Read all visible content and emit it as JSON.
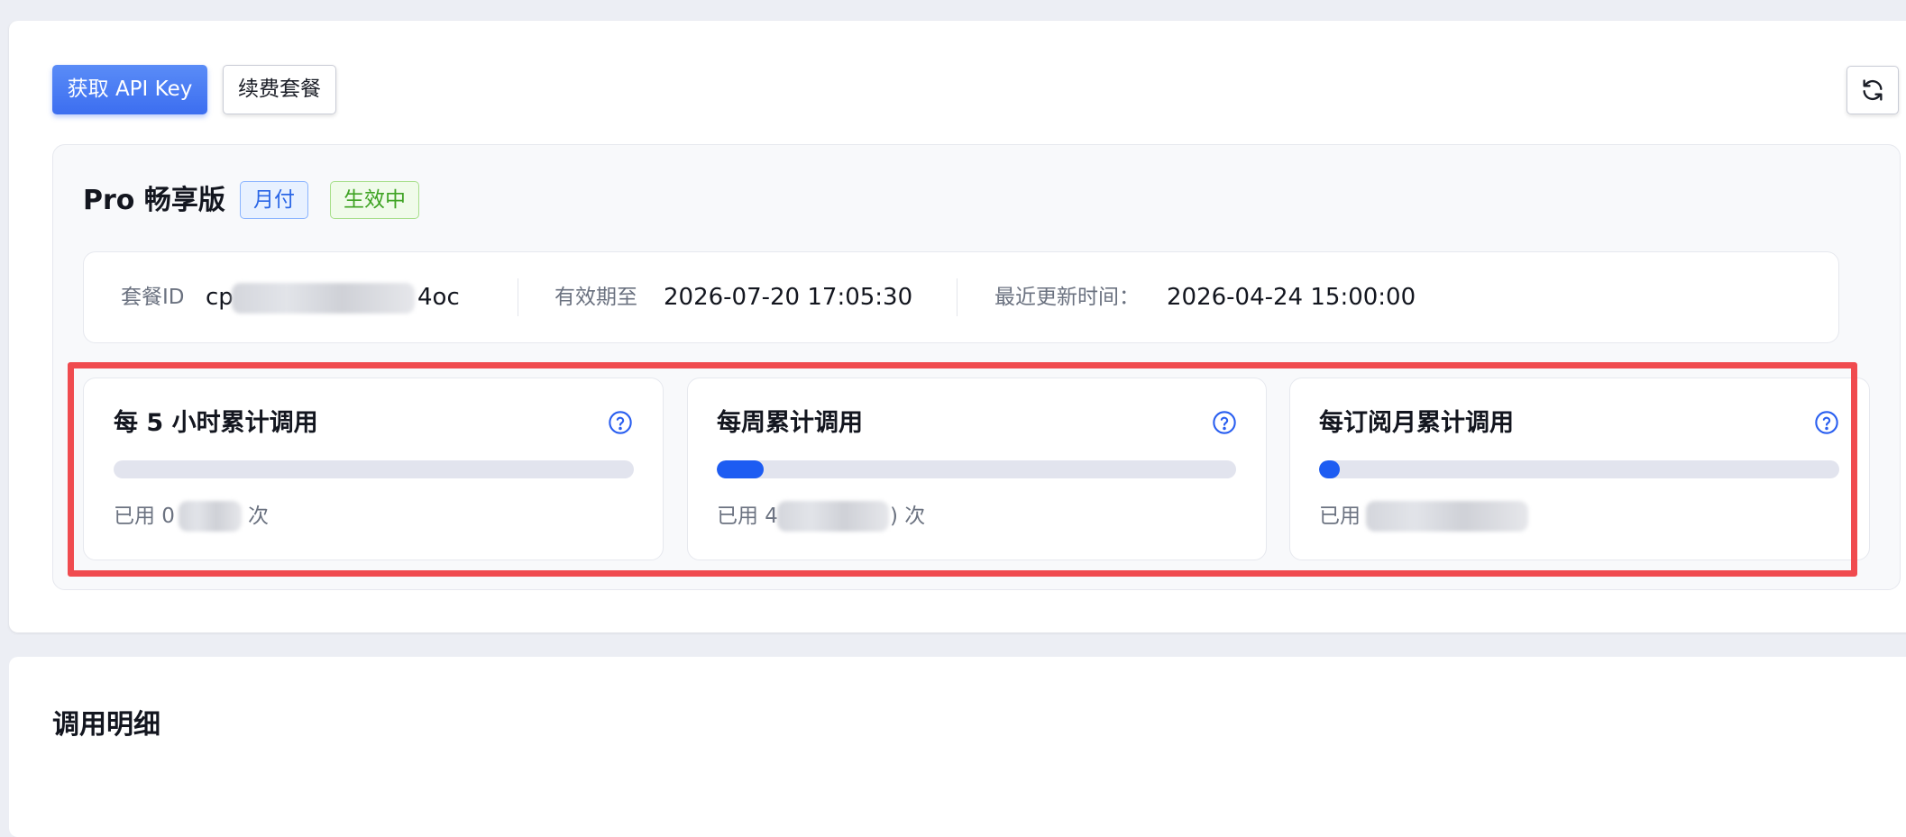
{
  "toolbar": {
    "get_api_key_label": "获取 API Key",
    "renew_label": "续费套餐",
    "refresh_icon": "refresh-icon"
  },
  "plan": {
    "name": "Pro 畅享版",
    "billing_tag": "月付",
    "status_tag": "生效中",
    "accent_color": "#1d5cf2",
    "info": {
      "id_label": "套餐ID",
      "id_prefix": "cp",
      "id_suffix": "4oc",
      "expiry_label": "有效期至",
      "expiry_value": "2026-07-20 17:05:30",
      "updated_label": "最近更新时间：",
      "updated_value": "2026-04-24 15:00:00"
    }
  },
  "usage": [
    {
      "title": "每 5 小时累计调用",
      "used_prefix": "已用 0",
      "used_suffix": "次",
      "progress": 0,
      "help_icon": "question-circle-icon"
    },
    {
      "title": "每周累计调用",
      "used_prefix": "已用 4",
      "used_suffix": ") 次",
      "progress": 0.09,
      "help_icon": "question-circle-icon"
    },
    {
      "title": "每订阅月累计调用",
      "used_prefix": "已用",
      "used_suffix": "",
      "progress": 0.04,
      "help_icon": "question-circle-icon"
    }
  ],
  "detail": {
    "title": "调用明细"
  }
}
